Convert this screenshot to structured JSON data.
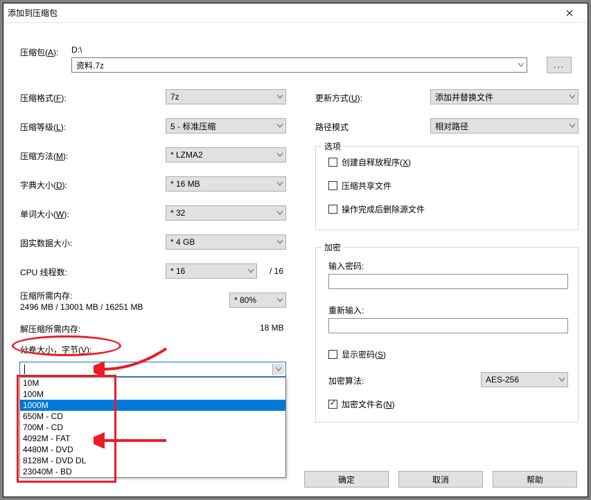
{
  "window": {
    "title": "添加到压缩包"
  },
  "archive": {
    "label": "压缩包(",
    "accel": "A",
    "label2": "):",
    "path": "D:\\",
    "name": "资料.7z",
    "browse": "..."
  },
  "left": {
    "format": {
      "label": "压缩格式(",
      "accel": "F",
      "label2": "):",
      "value": "7z"
    },
    "level": {
      "label": "压缩等级(",
      "accel": "L",
      "label2": "):",
      "value": "5 - 标准压缩"
    },
    "method": {
      "label": "压缩方法(",
      "accel": "M",
      "label2": "):",
      "value": "* LZMA2"
    },
    "dict": {
      "label": "字典大小(",
      "accel": "D",
      "label2": "):",
      "value": "* 16 MB"
    },
    "word": {
      "label": "单词大小(",
      "accel": "W",
      "label2": "):",
      "value": "* 32"
    },
    "solid": {
      "label": "固实数据大小:",
      "value": "* 4 GB"
    },
    "cpu": {
      "label": "CPU 线程数:",
      "value": "* 16",
      "total": "/ 16"
    },
    "mem_comp": {
      "label": "压缩所需内存:",
      "value": "2496 MB / 13001 MB / 16251 MB",
      "pct": "* 80%"
    },
    "mem_decomp": {
      "label": "解压缩所需内存:",
      "value": "18 MB"
    },
    "vol": {
      "label": "分卷大小，字节(",
      "accel": "V",
      "label2": "):",
      "value": ""
    },
    "vol_options": [
      "10M",
      "100M",
      "1000M",
      "650M - CD",
      "700M - CD",
      "4092M - FAT",
      "4480M - DVD",
      "8128M - DVD DL",
      "23040M - BD"
    ],
    "vol_selected_index": 2
  },
  "right": {
    "update": {
      "label": "更新方式(",
      "accel": "U",
      "label2": "):",
      "value": "添加并替换文件"
    },
    "pathmode": {
      "label": "路径模式",
      "value": "相对路径"
    },
    "options": {
      "legend": "选项",
      "sfx": {
        "label": "创建自释放程序(",
        "accel": "X",
        "label2": ")",
        "checked": false
      },
      "share": {
        "label": "压缩共享文件",
        "checked": false
      },
      "del": {
        "label": "操作完成后删除源文件",
        "checked": false
      }
    },
    "enc": {
      "legend": "加密",
      "pw_label": "输入密码:",
      "pw2_label": "重新输入:",
      "show": {
        "label": "显示密码(",
        "accel": "S",
        "label2": ")",
        "checked": false
      },
      "algo_label": "加密算法:",
      "algo_value": "AES-256",
      "encnames": {
        "label": "加密文件名(",
        "accel": "N",
        "label2": ")",
        "checked": true
      }
    }
  },
  "buttons": {
    "ok": "确定",
    "cancel": "取消",
    "help": "帮助"
  },
  "colors": {
    "accent": "#0078d7",
    "annotation": "#eb1c24"
  }
}
